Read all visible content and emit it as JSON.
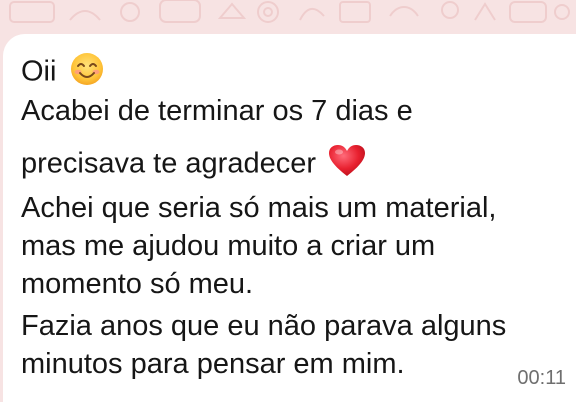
{
  "message": {
    "lines": [
      "Oii",
      "Acabei de terminar os 7 dias e",
      "precisava te agradecer",
      "Achei que seria só mais um material,",
      "mas me ajudou muito a criar um",
      "momento só meu.",
      "Fazia anos que eu não parava alguns",
      "minutos para pensar em mim."
    ],
    "time": "00:11",
    "emoji_after_line_1": "smiling-face-icon",
    "emoji_after_line_3": "red-heart-icon"
  },
  "colors": {
    "background": "#f7e3e3",
    "bubble": "#ffffff",
    "text": "#161616",
    "time": "#6f6f6f"
  }
}
